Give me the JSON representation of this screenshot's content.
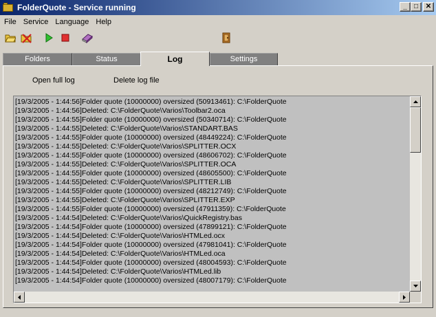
{
  "window": {
    "title": "FolderQuote - Service running",
    "minimize_label": "_",
    "maximize_label": "□",
    "close_label": "✕"
  },
  "menu": [
    "File",
    "Service",
    "Language",
    "Help"
  ],
  "toolbar": {
    "icons": [
      "open-folder-icon",
      "delete-folder-icon",
      "play-icon",
      "stop-icon",
      "book-icon",
      "exit-door-icon"
    ]
  },
  "tabs": [
    {
      "label": "Folders",
      "active": false
    },
    {
      "label": "Status",
      "active": false
    },
    {
      "label": "Log",
      "active": true
    },
    {
      "label": "Settings",
      "active": false
    }
  ],
  "log_panel": {
    "open_full_log": "Open full log",
    "delete_log_file": "Delete log file",
    "lines": [
      "[19/3/2005 - 1:44:56]Folder quote (10000000) oversized (50913461): C:\\FolderQuote",
      "[19/3/2005 - 1:44:56]Deleted: C:\\FolderQuote\\Varios\\Toolbar2.oca",
      "[19/3/2005 - 1:44:55]Folder quote (10000000) oversized (50340714): C:\\FolderQuote",
      "[19/3/2005 - 1:44:55]Deleted: C:\\FolderQuote\\Varios\\STANDART.BAS",
      "[19/3/2005 - 1:44:55]Folder quote (10000000) oversized (48449224): C:\\FolderQuote",
      "[19/3/2005 - 1:44:55]Deleted: C:\\FolderQuote\\Varios\\SPLITTER.OCX",
      "[19/3/2005 - 1:44:55]Folder quote (10000000) oversized (48606702): C:\\FolderQuote",
      "[19/3/2005 - 1:44:55]Deleted: C:\\FolderQuote\\Varios\\SPLITTER.OCA",
      "[19/3/2005 - 1:44:55]Folder quote (10000000) oversized (48605500): C:\\FolderQuote",
      "[19/3/2005 - 1:44:55]Deleted: C:\\FolderQuote\\Varios\\SPLITTER.LIB",
      "[19/3/2005 - 1:44:55]Folder quote (10000000) oversized (48212749): C:\\FolderQuote",
      "[19/3/2005 - 1:44:55]Deleted: C:\\FolderQuote\\Varios\\SPLITTER.EXP",
      "[19/3/2005 - 1:44:55]Folder quote (10000000) oversized (47911359): C:\\FolderQuote",
      "[19/3/2005 - 1:44:54]Deleted: C:\\FolderQuote\\Varios\\QuickRegistry.bas",
      "[19/3/2005 - 1:44:54]Folder quote (10000000) oversized (47899121): C:\\FolderQuote",
      "[19/3/2005 - 1:44:54]Deleted: C:\\FolderQuote\\Varios\\HTMLed.ocx",
      "[19/3/2005 - 1:44:54]Folder quote (10000000) oversized (47981041): C:\\FolderQuote",
      "[19/3/2005 - 1:44:54]Deleted: C:\\FolderQuote\\Varios\\HTMLed.oca",
      "[19/3/2005 - 1:44:54]Folder quote (10000000) oversized (48004593): C:\\FolderQuote",
      "[19/3/2005 - 1:44:54]Deleted: C:\\FolderQuote\\Varios\\HTMLed.lib",
      "[19/3/2005 - 1:44:54]Folder quote (10000000) oversized (48007179): C:\\FolderQuote"
    ]
  },
  "colors": {
    "title_gradient_start": "#0a246a",
    "title_gradient_end": "#a6caf0",
    "window_bg": "#d4d0c8",
    "log_bg": "#c0c0c0",
    "inactive_tab": "#808080"
  }
}
